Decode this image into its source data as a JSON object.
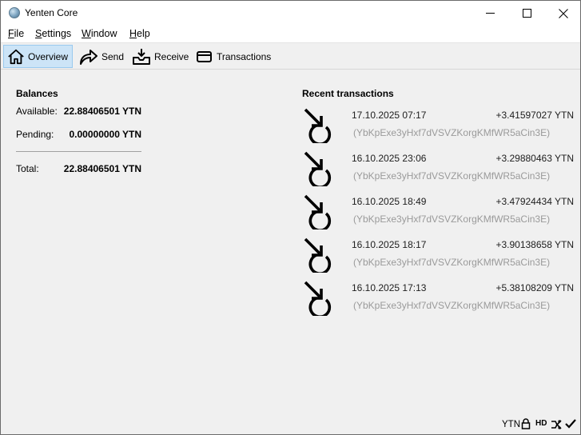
{
  "window": {
    "title": "Yenten Core"
  },
  "menu": {
    "items": [
      {
        "first": "F",
        "rest": "ile"
      },
      {
        "first": "S",
        "rest": "ettings"
      },
      {
        "first": "W",
        "rest": "indow"
      },
      {
        "first": "H",
        "rest": "elp"
      }
    ]
  },
  "toolbar": {
    "overview": "Overview",
    "send": "Send",
    "receive": "Receive",
    "transactions": "Transactions",
    "active": "overview"
  },
  "balances": {
    "title": "Balances",
    "available_label": "Available:",
    "available_value": "22.88406501 YTN",
    "pending_label": "Pending:",
    "pending_value": "0.00000000 YTN",
    "total_label": "Total:",
    "total_value": "22.88406501 YTN"
  },
  "recent": {
    "title": "Recent transactions",
    "transactions": [
      {
        "date": "17.10.2025 07:17",
        "amount": "+3.41597027 YTN",
        "address": "(YbKpExe3yHxf7dVSVZKorgKMfWR5aCin3E)"
      },
      {
        "date": "16.10.2025 23:06",
        "amount": "+3.29880463 YTN",
        "address": "(YbKpExe3yHxf7dVSVZKorgKMfWR5aCin3E)"
      },
      {
        "date": "16.10.2025 18:49",
        "amount": "+3.47924434 YTN",
        "address": "(YbKpExe3yHxf7dVSVZKorgKMfWR5aCin3E)"
      },
      {
        "date": "16.10.2025 18:17",
        "amount": "+3.90138658 YTN",
        "address": "(YbKpExe3yHxf7dVSVZKorgKMfWR5aCin3E)"
      },
      {
        "date": "16.10.2025 17:13",
        "amount": "+5.38108209 YTN",
        "address": "(YbKpExe3yHxf7dVSVZKorgKMfWR5aCin3E)"
      }
    ]
  },
  "statusbar": {
    "unit": "YTN",
    "hd": "HD",
    "icons": [
      "lock-icon",
      "hd-icon",
      "network-icon",
      "synced-check-icon"
    ]
  },
  "colors": {
    "active_tab_bg": "#cce4f7",
    "active_tab_border": "#99c9ef",
    "address_text": "#9a9a9a"
  }
}
